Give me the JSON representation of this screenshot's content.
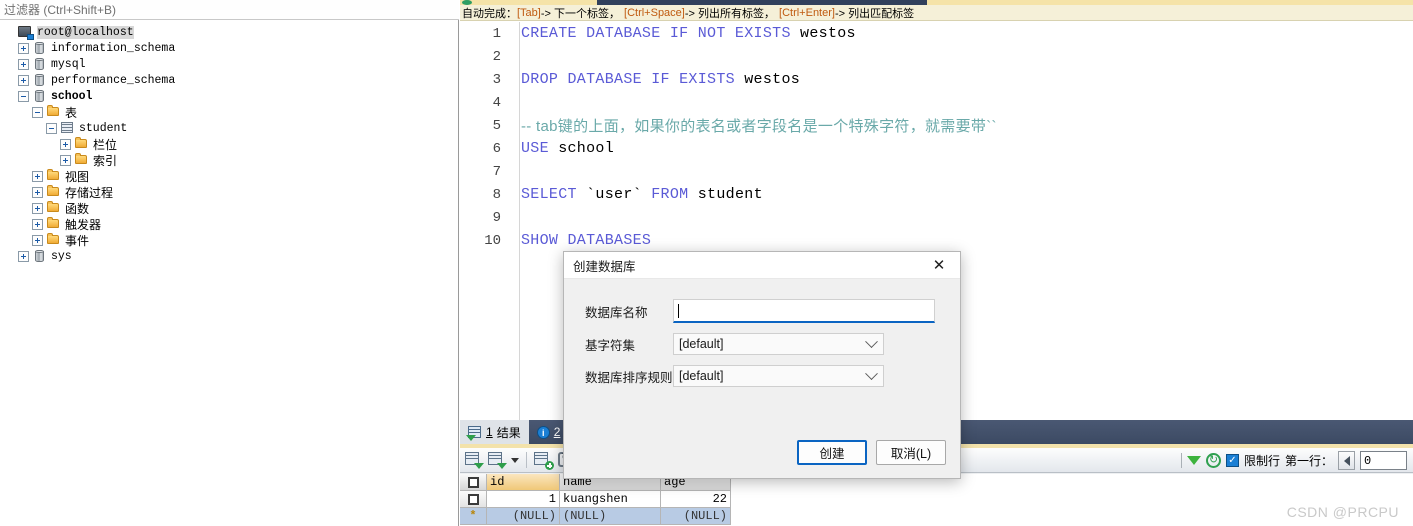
{
  "sidebar": {
    "filter_placeholder": "过滤器 (Ctrl+Shift+B)",
    "tree": [
      {
        "label": "root@localhost",
        "icon": "server-icon",
        "depth": 0,
        "expander": "none",
        "style": "mono selected"
      },
      {
        "label": "information_schema",
        "icon": "database-icon",
        "depth": 1,
        "expander": "plus",
        "style": "mono"
      },
      {
        "label": "mysql",
        "icon": "database-icon",
        "depth": 1,
        "expander": "plus",
        "style": "mono"
      },
      {
        "label": "performance_schema",
        "icon": "database-icon",
        "depth": 1,
        "expander": "plus",
        "style": "mono"
      },
      {
        "label": "school",
        "icon": "database-icon",
        "depth": 1,
        "expander": "minus",
        "style": "mono bold"
      },
      {
        "label": "表",
        "icon": "folder-icon",
        "depth": 2,
        "expander": "minus",
        "style": "cn"
      },
      {
        "label": "student",
        "icon": "table-icon",
        "depth": 3,
        "expander": "minus",
        "style": "mono"
      },
      {
        "label": "栏位",
        "icon": "folder-icon",
        "depth": 4,
        "expander": "plus",
        "style": "cn"
      },
      {
        "label": "索引",
        "icon": "folder-icon",
        "depth": 4,
        "expander": "plus",
        "style": "cn"
      },
      {
        "label": "视图",
        "icon": "folder-icon",
        "depth": 2,
        "expander": "plus",
        "style": "cn"
      },
      {
        "label": "存储过程",
        "icon": "folder-icon",
        "depth": 2,
        "expander": "plus",
        "style": "cn"
      },
      {
        "label": "函数",
        "icon": "folder-icon",
        "depth": 2,
        "expander": "plus",
        "style": "cn"
      },
      {
        "label": "触发器",
        "icon": "folder-icon",
        "depth": 2,
        "expander": "plus",
        "style": "cn"
      },
      {
        "label": "事件",
        "icon": "folder-icon",
        "depth": 2,
        "expander": "plus",
        "style": "cn"
      },
      {
        "label": "sys",
        "icon": "database-icon",
        "depth": 1,
        "expander": "plus",
        "style": "mono"
      }
    ]
  },
  "hintbar": {
    "prefix": "自动完成：",
    "k1": "[Tab]",
    "t1": "-> 下一个标签，",
    "k2": "[Ctrl+Space]",
    "t2": "-> 列出所有标签，",
    "k3": "[Ctrl+Enter]",
    "t3": "-> 列出匹配标签"
  },
  "editor": {
    "lines": [
      {
        "n": "1",
        "kw": "CREATE DATABASE IF NOT EXISTS",
        "id": " westos",
        "comment": ""
      },
      {
        "n": "2",
        "kw": "",
        "id": "",
        "comment": ""
      },
      {
        "n": "3",
        "kw": "DROP DATABASE IF EXISTS",
        "id": " westos",
        "comment": ""
      },
      {
        "n": "4",
        "kw": "",
        "id": "",
        "comment": ""
      },
      {
        "n": "5",
        "kw": "",
        "id": "",
        "comment": "-- tab键的上面，如果你的表名或者字段名是一个特殊字符，就需要带``"
      },
      {
        "n": "6",
        "kw": "USE",
        "id": " school",
        "comment": ""
      },
      {
        "n": "7",
        "kw": "",
        "id": "",
        "comment": ""
      },
      {
        "n": "8",
        "kw": "SELECT",
        "id": " `user` ",
        "kw2": "FROM",
        "id2": " student",
        "comment": ""
      },
      {
        "n": "9",
        "kw": "",
        "id": "",
        "comment": ""
      },
      {
        "n": "10",
        "kw": "SHOW DATABASES",
        "id": "",
        "comment": ""
      }
    ]
  },
  "results": {
    "tabs": [
      {
        "num": "1",
        "label": "结果",
        "icon": "result-grid-icon",
        "active": true
      },
      {
        "num": "2",
        "label": "",
        "icon": "info-icon",
        "active": false
      }
    ],
    "toolbar_icons": [
      "grid-icon",
      "grid-export-icon",
      "dropdown-caret-icon",
      "add-record-icon",
      "refresh-record-icon"
    ],
    "columns": [
      "id",
      "name",
      "age"
    ],
    "rows": [
      {
        "id": "1",
        "name": "kuangshen",
        "age": "22"
      },
      {
        "id": "(NULL)",
        "name": "(NULL)",
        "age": "(NULL)"
      }
    ],
    "status": {
      "filter_icon": "funnel-icon",
      "refresh_icon": "refresh-icon",
      "limit_rows_checked": true,
      "limit_rows_label": "限制行",
      "first_row_label": "第一行：",
      "first_row_value": "0"
    }
  },
  "dialog": {
    "title": "创建数据库",
    "close_icon": "close-icon",
    "fields": [
      {
        "label": "数据库名称",
        "type": "text",
        "value": "",
        "placeholder": ""
      },
      {
        "label": "基字符集",
        "type": "select",
        "value": "[default]"
      },
      {
        "label": "数据库排序规则",
        "type": "select",
        "value": "[default]"
      }
    ],
    "buttons": {
      "confirm": "创建",
      "cancel": "取消(L)"
    }
  },
  "watermark": "CSDN @PRCPU",
  "colors": {
    "accent_blue": "#0a64c2",
    "keyword_blue": "#5a5ad6",
    "comment_teal": "#6aa9a9",
    "hint_orange": "#c05a10",
    "tabbar_navy": "#3c4a63",
    "pk_amber": "#f0c878"
  }
}
